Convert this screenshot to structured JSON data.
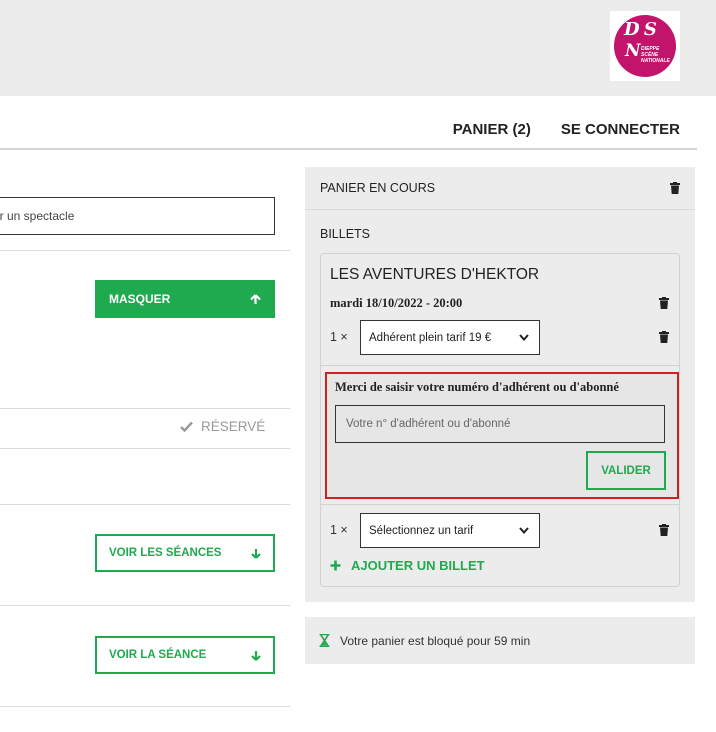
{
  "logo": {
    "mark": "D S",
    "line1": "DIEPPE",
    "line2": "SCÈNE",
    "line3": "NATIONALE"
  },
  "nav": {
    "cart_label": "PANIER (2)",
    "login_label": "SE CONNECTER"
  },
  "search": {
    "value": "er un spectacle"
  },
  "show_list": {
    "hide_button": "MASQUER",
    "reserved_label": "RÉSERVÉ",
    "see_sessions_button": "VOIR LES SÉANCES",
    "see_session_button": "VOIR LA SÉANCE"
  },
  "cart": {
    "title": "PANIER EN COURS",
    "section_label": "BILLETS",
    "show_title": "LES AVENTURES D'HEKTOR",
    "show_date": "mardi 18/10/2022 - 20:00",
    "line1": {
      "qty": "1 ×",
      "tariff": "Adhérent plein tarif 19 €"
    },
    "member": {
      "label": "Merci de saisir votre numéro d'adhérent ou d'abonné",
      "placeholder": "Votre n° d'adhérent ou d'abonné",
      "validate_label": "VALIDER"
    },
    "line2": {
      "qty": "1 ×",
      "tariff": "Sélectionnez un tarif"
    },
    "add_ticket_label": "AJOUTER UN BILLET"
  },
  "timer": {
    "text": "Votre panier est bloqué pour 59 min"
  },
  "colors": {
    "green": "#1faa4f",
    "red": "#d71c24",
    "brand": "#c2146a"
  }
}
